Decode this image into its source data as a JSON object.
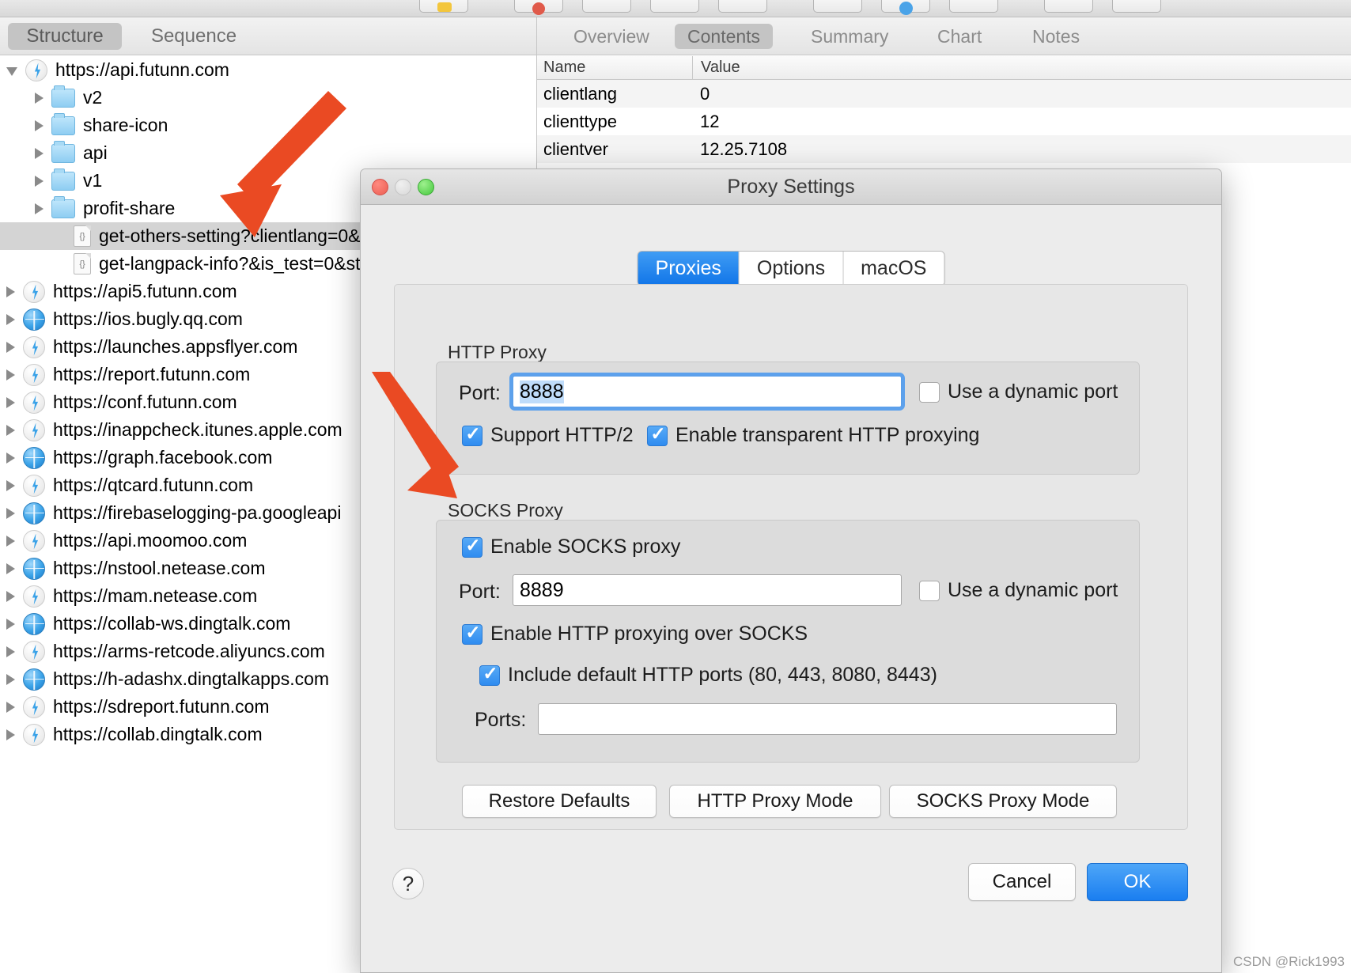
{
  "app": {
    "left_tabs": [
      {
        "label": "Structure",
        "active": true
      },
      {
        "label": "Sequence",
        "active": false
      }
    ],
    "right_tabs": [
      {
        "label": "Overview",
        "active": false
      },
      {
        "label": "Contents",
        "active": true
      },
      {
        "label": "Summary",
        "active": false
      },
      {
        "label": "Chart",
        "active": false
      },
      {
        "label": "Notes",
        "active": false
      }
    ],
    "contents_table": {
      "columns": [
        "Name",
        "Value"
      ],
      "rows": [
        {
          "name": "clientlang",
          "value": "0"
        },
        {
          "name": "clienttype",
          "value": "12"
        },
        {
          "name": "clientver",
          "value": "12.25.7108"
        }
      ]
    },
    "tree": [
      {
        "label": "https://api.futunn.com",
        "icon": "bolt-icon",
        "depth": 0,
        "expanded": true,
        "selected": false
      },
      {
        "label": "v2",
        "icon": "folder-icon",
        "depth": 1,
        "expanded": false,
        "selected": false
      },
      {
        "label": "share-icon",
        "icon": "folder-icon",
        "depth": 1,
        "expanded": false,
        "selected": false
      },
      {
        "label": "api",
        "icon": "folder-icon",
        "depth": 1,
        "expanded": false,
        "selected": false
      },
      {
        "label": "v1",
        "icon": "folder-icon",
        "depth": 1,
        "expanded": false,
        "selected": false
      },
      {
        "label": "profit-share",
        "icon": "folder-icon",
        "depth": 1,
        "expanded": false,
        "selected": false
      },
      {
        "label": "get-others-setting?clientlang=0&",
        "icon": "json-doc-icon",
        "depth": 2,
        "expanded": null,
        "selected": true
      },
      {
        "label": "get-langpack-info?&is_test=0&st",
        "icon": "json-doc-icon",
        "depth": 2,
        "expanded": null,
        "selected": false
      },
      {
        "label": "https://api5.futunn.com",
        "icon": "bolt-icon",
        "depth": 0,
        "expanded": false,
        "selected": false
      },
      {
        "label": "https://ios.bugly.qq.com",
        "icon": "globe-icon",
        "depth": 0,
        "expanded": false,
        "selected": false
      },
      {
        "label": "https://launches.appsflyer.com",
        "icon": "bolt-icon",
        "depth": 0,
        "expanded": false,
        "selected": false
      },
      {
        "label": "https://report.futunn.com",
        "icon": "bolt-icon",
        "depth": 0,
        "expanded": false,
        "selected": false
      },
      {
        "label": "https://conf.futunn.com",
        "icon": "bolt-icon",
        "depth": 0,
        "expanded": false,
        "selected": false
      },
      {
        "label": "https://inappcheck.itunes.apple.com",
        "icon": "bolt-icon",
        "depth": 0,
        "expanded": false,
        "selected": false
      },
      {
        "label": "https://graph.facebook.com",
        "icon": "globe-icon",
        "depth": 0,
        "expanded": false,
        "selected": false
      },
      {
        "label": "https://qtcard.futunn.com",
        "icon": "bolt-icon",
        "depth": 0,
        "expanded": false,
        "selected": false
      },
      {
        "label": "https://firebaselogging-pa.googleapi",
        "icon": "globe-icon",
        "depth": 0,
        "expanded": false,
        "selected": false
      },
      {
        "label": "https://api.moomoo.com",
        "icon": "bolt-icon",
        "depth": 0,
        "expanded": false,
        "selected": false
      },
      {
        "label": "https://nstool.netease.com",
        "icon": "globe-icon",
        "depth": 0,
        "expanded": false,
        "selected": false
      },
      {
        "label": "https://mam.netease.com",
        "icon": "bolt-icon",
        "depth": 0,
        "expanded": false,
        "selected": false
      },
      {
        "label": "https://collab-ws.dingtalk.com",
        "icon": "globe-icon",
        "depth": 0,
        "expanded": false,
        "selected": false
      },
      {
        "label": "https://arms-retcode.aliyuncs.com",
        "icon": "bolt-icon",
        "depth": 0,
        "expanded": false,
        "selected": false
      },
      {
        "label": "https://h-adashx.dingtalkapps.com",
        "icon": "globe-icon",
        "depth": 0,
        "expanded": false,
        "selected": false
      },
      {
        "label": "https://sdreport.futunn.com",
        "icon": "bolt-icon",
        "depth": 0,
        "expanded": false,
        "selected": false
      },
      {
        "label": "https://collab.dingtalk.com",
        "icon": "bolt-icon",
        "depth": 0,
        "expanded": false,
        "selected": false
      }
    ]
  },
  "dialog": {
    "title": "Proxy Settings",
    "tabs": [
      {
        "label": "Proxies",
        "active": true
      },
      {
        "label": "Options",
        "active": false
      },
      {
        "label": "macOS",
        "active": false
      }
    ],
    "http_proxy": {
      "section_label": "HTTP Proxy",
      "port_label": "Port:",
      "port_value": "8888",
      "dynamic_port_label": "Use a dynamic port",
      "dynamic_port_checked": false,
      "support_http2_label": "Support HTTP/2",
      "support_http2_checked": true,
      "transparent_label": "Enable transparent HTTP proxying",
      "transparent_checked": true
    },
    "socks_proxy": {
      "section_label": "SOCKS Proxy",
      "enable_label": "Enable SOCKS proxy",
      "enable_checked": true,
      "port_label": "Port:",
      "port_value": "8889",
      "dynamic_port_label": "Use a dynamic port",
      "dynamic_port_checked": false,
      "http_over_socks_label": "Enable HTTP proxying over SOCKS",
      "http_over_socks_checked": true,
      "include_default_label": "Include default HTTP ports (80, 443, 8080, 8443)",
      "include_default_checked": true,
      "ports_label": "Ports:",
      "ports_value": ""
    },
    "mode_buttons": [
      {
        "label": "Restore Defaults"
      },
      {
        "label": "HTTP Proxy Mode"
      },
      {
        "label": "SOCKS Proxy Mode"
      }
    ],
    "help_glyph": "?",
    "footer": {
      "cancel_label": "Cancel",
      "ok_label": "OK"
    }
  },
  "annotations": {
    "arrow_color": "#ea4a23",
    "arrow_count": 2
  },
  "watermark": "CSDN @Rick1993"
}
